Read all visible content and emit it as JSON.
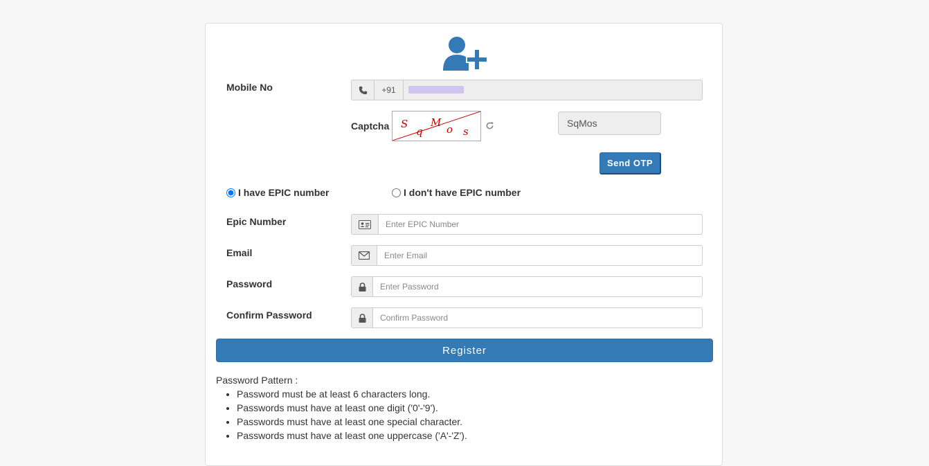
{
  "form": {
    "mobile": {
      "label": "Mobile No",
      "country_code": "+91",
      "value": ""
    },
    "captcha": {
      "label": "Captcha",
      "image_text": [
        "S",
        "q",
        "M",
        "o",
        "s"
      ],
      "input_value": "SqMos"
    },
    "send_otp_label": "Send OTP",
    "epic_options": {
      "have": "I have EPIC number",
      "dont_have": "I don't have EPIC number",
      "selected": "have"
    },
    "epic": {
      "label": "Epic Number",
      "placeholder": "Enter EPIC Number"
    },
    "email": {
      "label": "Email",
      "placeholder": "Enter Email"
    },
    "password": {
      "label": "Password",
      "placeholder": "Enter Password"
    },
    "confirm_password": {
      "label": "Confirm Password",
      "placeholder": "Confirm Password"
    },
    "register_label": "Register"
  },
  "password_pattern": {
    "title": "Password Pattern :",
    "rules": [
      "Password must be at least 6 characters long.",
      "Passwords must have at least one digit ('0'-'9').",
      "Passwords must have at least one special character.",
      "Passwords must have at least one uppercase ('A'-'Z')."
    ]
  },
  "icons": {
    "logo": "add-user-icon",
    "mobile": "phone-icon",
    "refresh": "refresh-icon",
    "epic": "id-card-icon",
    "email": "envelope-icon",
    "password": "lock-icon"
  },
  "colors": {
    "primary": "#337ab7",
    "captcha_ink": "#cc0000",
    "background": "#f7f7f7"
  }
}
